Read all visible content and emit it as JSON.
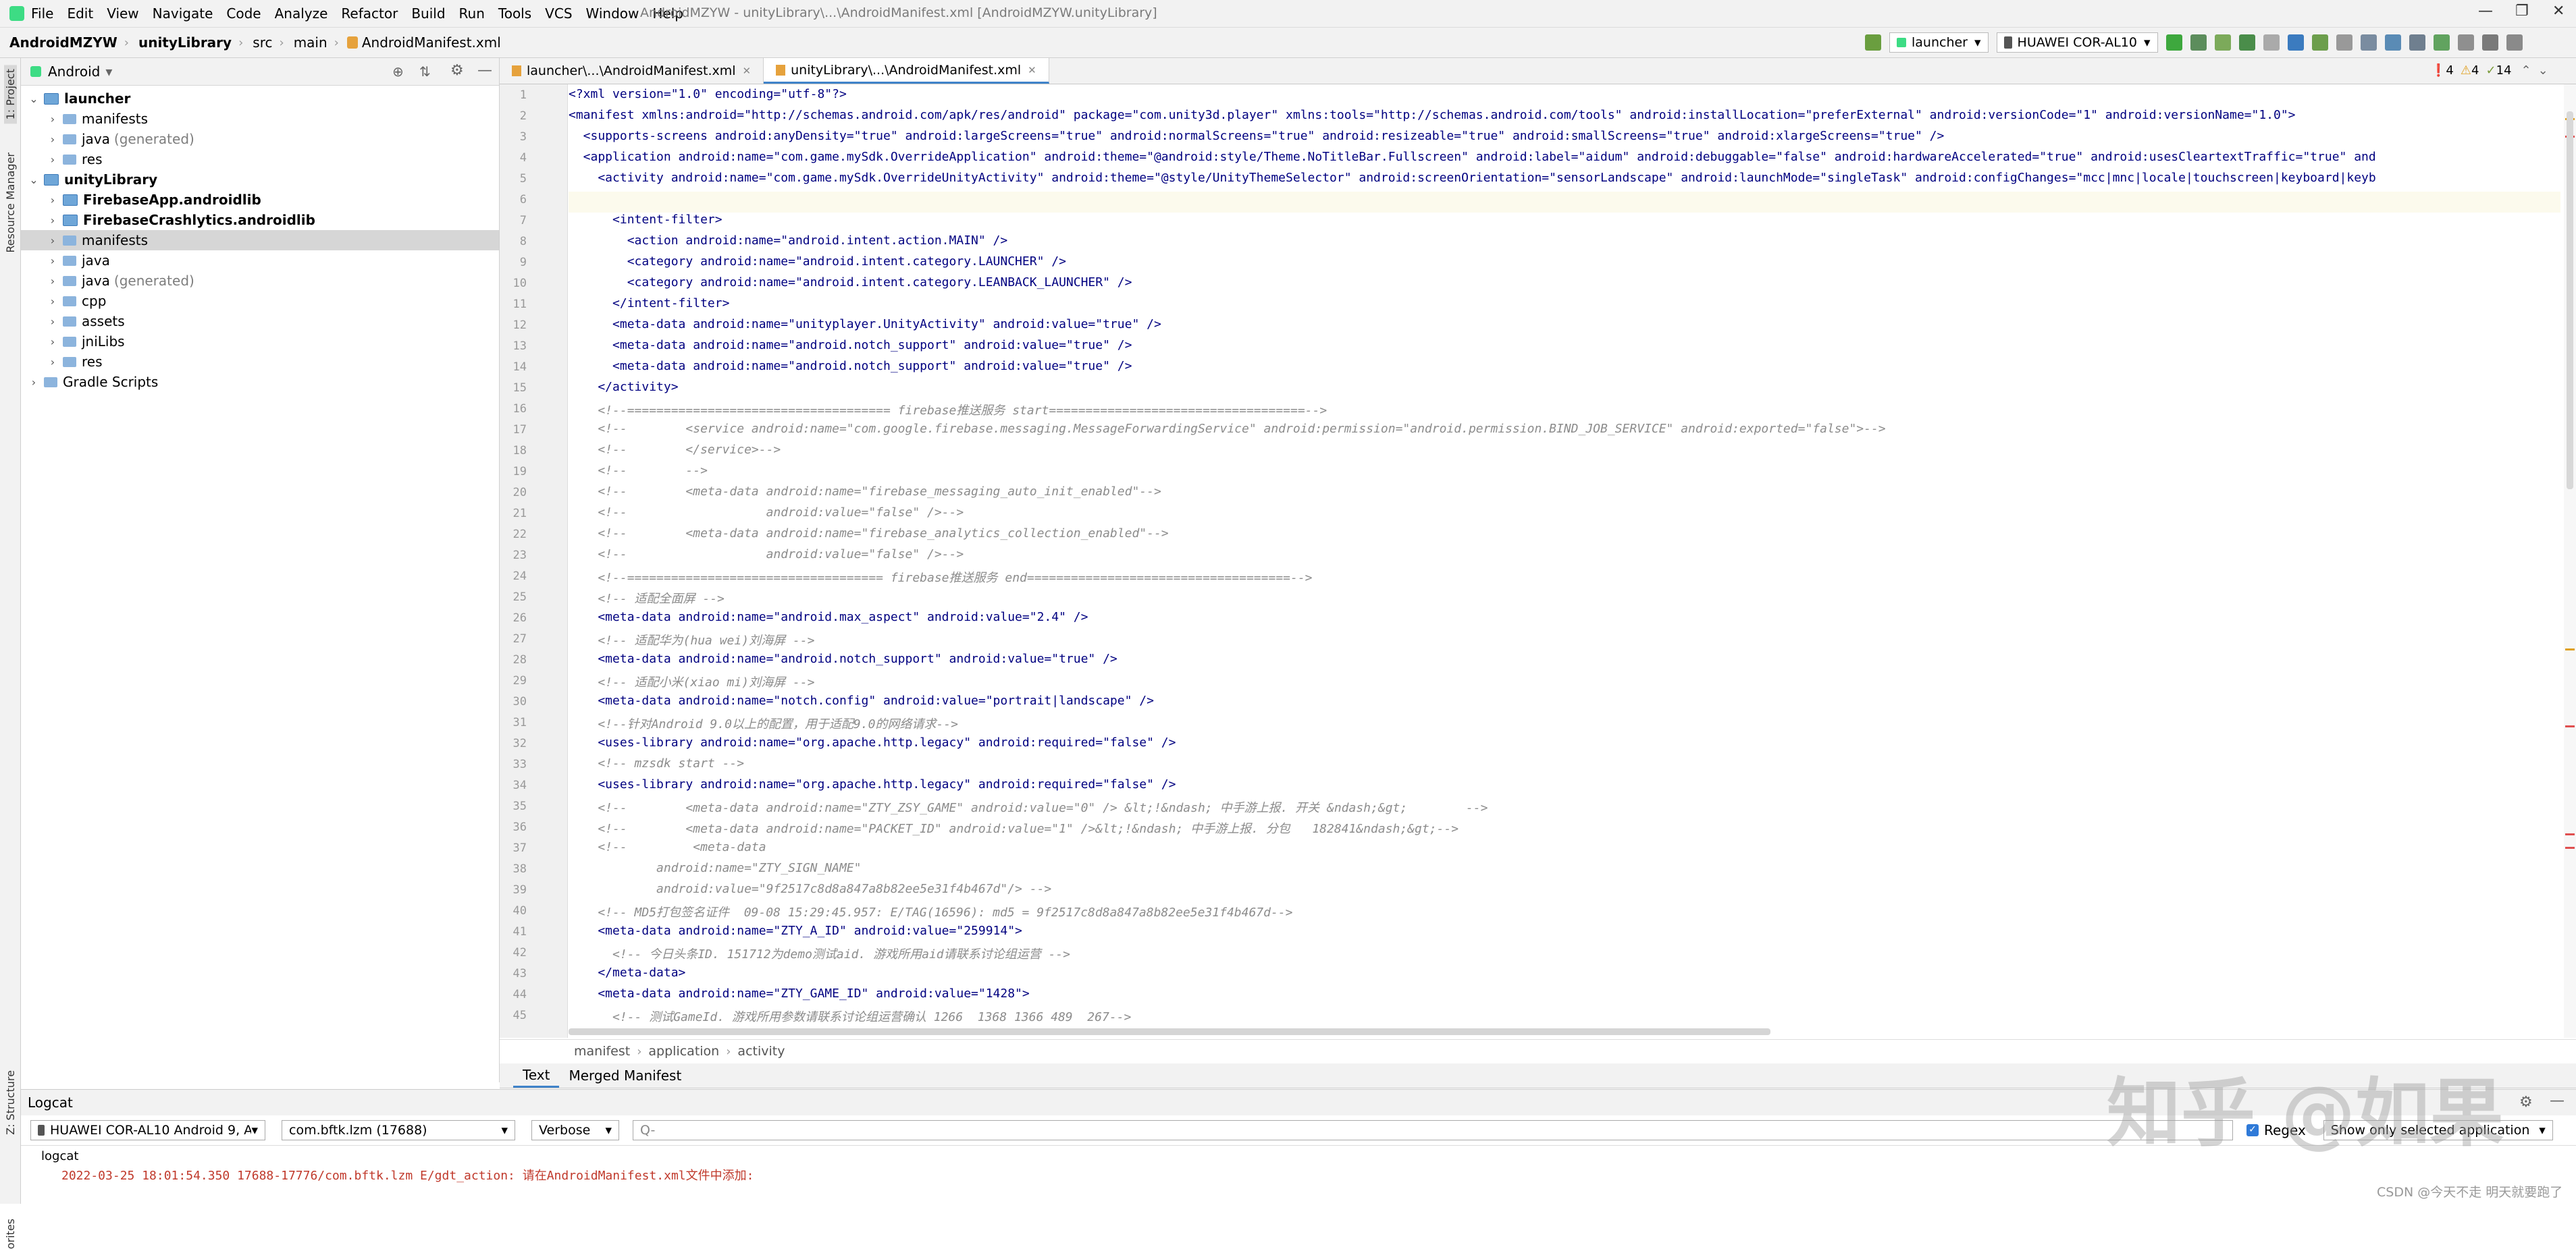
{
  "menubar": {
    "items": [
      "File",
      "Edit",
      "View",
      "Navigate",
      "Code",
      "Analyze",
      "Refactor",
      "Build",
      "Run",
      "Tools",
      "VCS",
      "Window",
      "Help"
    ],
    "window_title": "AndroidMZYW - unityLibrary\\...\\AndroidManifest.xml [AndroidMZYW.unityLibrary]",
    "minimize": "—",
    "maximize": "❐",
    "close": "✕"
  },
  "navbar": {
    "crumbs": [
      "AndroidMZYW",
      "unityLibrary",
      "src",
      "main",
      "AndroidManifest.xml"
    ],
    "run_config": "launcher",
    "device": "HUAWEI COR-AL10"
  },
  "side_strips": {
    "project": "1: Project",
    "resource_manager": "Resource Manager",
    "structure": "Z: Structure",
    "favorites": "orites"
  },
  "project": {
    "view": "Android",
    "tree": [
      {
        "label": "launcher",
        "bold": true,
        "level": 0,
        "open": true
      },
      {
        "label": "manifests",
        "level": 1
      },
      {
        "label": "java",
        "suffix": "(generated)",
        "level": 1
      },
      {
        "label": "res",
        "level": 1
      },
      {
        "label": "unityLibrary",
        "bold": true,
        "level": 0,
        "open": true
      },
      {
        "label": "FirebaseApp.androidlib",
        "bold": true,
        "level": 1
      },
      {
        "label": "FirebaseCrashlytics.androidlib",
        "bold": true,
        "level": 1
      },
      {
        "label": "manifests",
        "level": 1,
        "selected": true
      },
      {
        "label": "java",
        "level": 1
      },
      {
        "label": "java",
        "suffix": "(generated)",
        "level": 1
      },
      {
        "label": "cpp",
        "level": 1
      },
      {
        "label": "assets",
        "level": 1
      },
      {
        "label": "jniLibs",
        "level": 1
      },
      {
        "label": "res",
        "level": 1
      },
      {
        "label": "Gradle Scripts",
        "level": 0
      }
    ]
  },
  "editor": {
    "tabs": [
      "launcher\\...\\AndroidManifest.xml",
      "unityLibrary\\...\\AndroidManifest.xml"
    ],
    "active_tab": 1,
    "errors": "4",
    "warnings": "4",
    "weak_warnings": "14",
    "lines": [
      "<?xml version=\"1.0\" encoding=\"utf-8\"?>",
      "<manifest xmlns:android=\"http://schemas.android.com/apk/res/android\" package=\"com.unity3d.player\" xmlns:tools=\"http://schemas.android.com/tools\" android:installLocation=\"preferExternal\" android:versionCode=\"1\" android:versionName=\"1.0\">",
      "  <supports-screens android:anyDensity=\"true\" android:largeScreens=\"true\" android:normalScreens=\"true\" android:resizeable=\"true\" android:smallScreens=\"true\" android:xlargeScreens=\"true\" />",
      "  <application android:name=\"com.game.mySdk.OverrideApplication\" android:theme=\"@android:style/Theme.NoTitleBar.Fullscreen\" android:label=\"aidum\" android:debuggable=\"false\" android:hardwareAccelerated=\"true\" android:usesCleartextTraffic=\"true\" and",
      "    <activity android:name=\"com.game.mySdk.OverrideUnityActivity\" android:theme=\"@style/UnityThemeSelector\" android:screenOrientation=\"sensorLandscape\" android:launchMode=\"singleTask\" android:configChanges=\"mcc|mnc|locale|touchscreen|keyboard|keyb",
      "",
      "      <intent-filter>",
      "        <action android:name=\"android.intent.action.MAIN\" />",
      "        <category android:name=\"android.intent.category.LAUNCHER\" />",
      "        <category android:name=\"android.intent.category.LEANBACK_LAUNCHER\" />",
      "      </intent-filter>",
      "      <meta-data android:name=\"unityplayer.UnityActivity\" android:value=\"true\" />",
      "      <meta-data android:name=\"android.notch_support\" android:value=\"true\" />",
      "      <meta-data android:name=\"android.notch_support\" android:value=\"true\" />",
      "    </activity>",
      "    <!--==================================== firebase推送服务 start===================================-->",
      "    <!--        <service android:name=\"com.google.firebase.messaging.MessageForwardingService\" android:permission=\"android.permission.BIND_JOB_SERVICE\" android:exported=\"false\">-->",
      "    <!--        </service>-->",
      "    <!--        -->",
      "    <!--        <meta-data android:name=\"firebase_messaging_auto_init_enabled\"-->",
      "    <!--                   android:value=\"false\" />-->",
      "    <!--        <meta-data android:name=\"firebase_analytics_collection_enabled\"-->",
      "    <!--                   android:value=\"false\" />-->",
      "    <!--=================================== firebase推送服务 end====================================-->",
      "    <!-- 适配全面屏 -->",
      "    <meta-data android:name=\"android.max_aspect\" android:value=\"2.4\" />",
      "    <!-- 适配华为(hua wei)刘海屏 -->",
      "    <meta-data android:name=\"android.notch_support\" android:value=\"true\" />",
      "    <!-- 适配小米(xiao mi)刘海屏 -->",
      "    <meta-data android:name=\"notch.config\" android:value=\"portrait|landscape\" />",
      "    <!--针对Android 9.0以上的配置，用于适配9.0的网络请求-->",
      "    <uses-library android:name=\"org.apache.http.legacy\" android:required=\"false\" />",
      "    <!-- mzsdk start -->",
      "    <uses-library android:name=\"org.apache.http.legacy\" android:required=\"false\" />",
      "    <!--        <meta-data android:name=\"ZTY_ZSY_GAME\" android:value=\"0\" /> &lt;!&ndash; 中手游上报. 开关 &ndash;&gt;        -->",
      "    <!--        <meta-data android:name=\"PACKET_ID\" android:value=\"1\" />&lt;!&ndash; 中手游上报. 分包   182841&ndash;&gt;-->",
      "    <!--         <meta-data",
      "            android:name=\"ZTY_SIGN_NAME\"",
      "            android:value=\"9f2517c8d8a847a8b82ee5e31f4b467d\"/> -->",
      "    <!-- MD5打包签名证件  09-08 15:29:45.957: E/TAG(16596): md5 = 9f2517c8d8a847a8b82ee5e31f4b467d-->",
      "    <meta-data android:name=\"ZTY_A_ID\" android:value=\"259914\">",
      "      <!-- 今日头条ID. 151712为demo测试aid. 游戏所用aid请联系讨论组运营 -->",
      "    </meta-data>",
      "    <meta-data android:name=\"ZTY_GAME_ID\" android:value=\"1428\">",
      "      <!-- 测试GameId. 游戏所用参数请联系讨论组运营确认 1266  1368 1366 489  267-->"
    ],
    "breadcrumbs": [
      "manifest",
      "application",
      "activity"
    ],
    "bottom_tabs": [
      "Text",
      "Merged Manifest"
    ]
  },
  "logcat": {
    "title": "Logcat",
    "device": "HUAWEI COR-AL10 Android 9, A",
    "process": "com.bftk.lzm (17688)",
    "level": "Verbose",
    "search_placeholder": "Q-",
    "regex_label": "Regex",
    "filter": "Show only selected application",
    "tab": "logcat",
    "line": "2022-03-25 18:01:54.350 17688-17776/com.bftk.lzm E/gdt_action: 请在AndroidManifest.xml文件中添加:"
  },
  "watermark": {
    "main": "知乎 @如果",
    "sub": "CSDN @今天不走 明天就要跑了"
  }
}
